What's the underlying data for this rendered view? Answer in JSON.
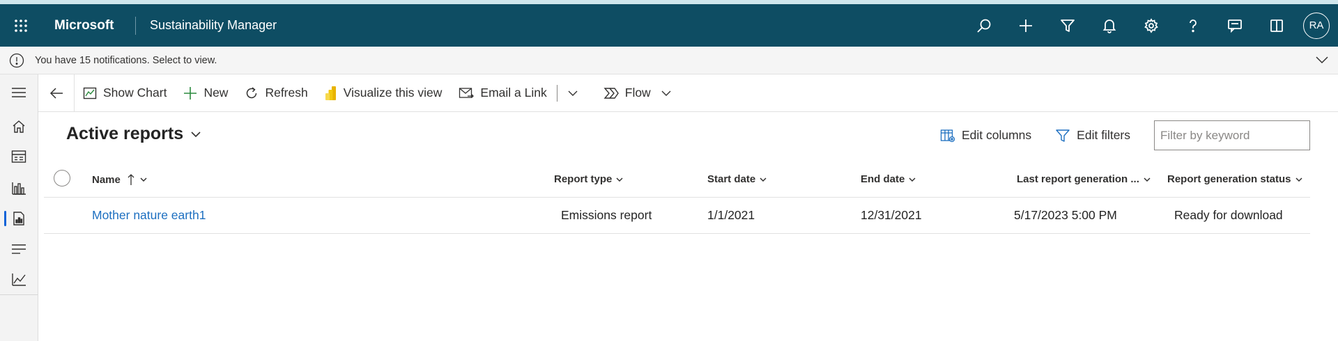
{
  "topbar": {
    "brand": "Microsoft",
    "app_name": "Sustainability Manager",
    "avatar_initials": "RA",
    "icons": [
      "search-icon",
      "add-icon",
      "filter-icon",
      "bell-icon",
      "gear-icon",
      "help-icon",
      "feedback-icon",
      "book-icon"
    ]
  },
  "notification": {
    "text": "You have 15 notifications. Select to view."
  },
  "sidebar": {
    "items": [
      "home-icon",
      "calculator-icon",
      "chart-icon",
      "report-icon",
      "list-icon",
      "line-chart-icon"
    ],
    "active_index": 3
  },
  "commandbar": {
    "show_chart": "Show Chart",
    "new": "New",
    "refresh": "Refresh",
    "visualize": "Visualize this view",
    "email": "Email a Link",
    "flow": "Flow"
  },
  "view": {
    "title": "Active reports",
    "edit_columns": "Edit columns",
    "edit_filters": "Edit filters",
    "filter_placeholder": "Filter by keyword"
  },
  "table": {
    "columns": [
      "Name",
      "Report type",
      "Start date",
      "End date",
      "Last report generation ...",
      "Report generation status"
    ],
    "rows": [
      {
        "name": "Mother nature earth1",
        "report_type": "Emissions report",
        "start_date": "1/1/2021",
        "end_date": "12/31/2021",
        "last_generation": "5/17/2023 5:00 PM",
        "status": "Ready for download"
      }
    ]
  },
  "colors": {
    "header_bg": "#0e4d63",
    "link": "#1d6fc0",
    "accent": "#0e63d8"
  }
}
